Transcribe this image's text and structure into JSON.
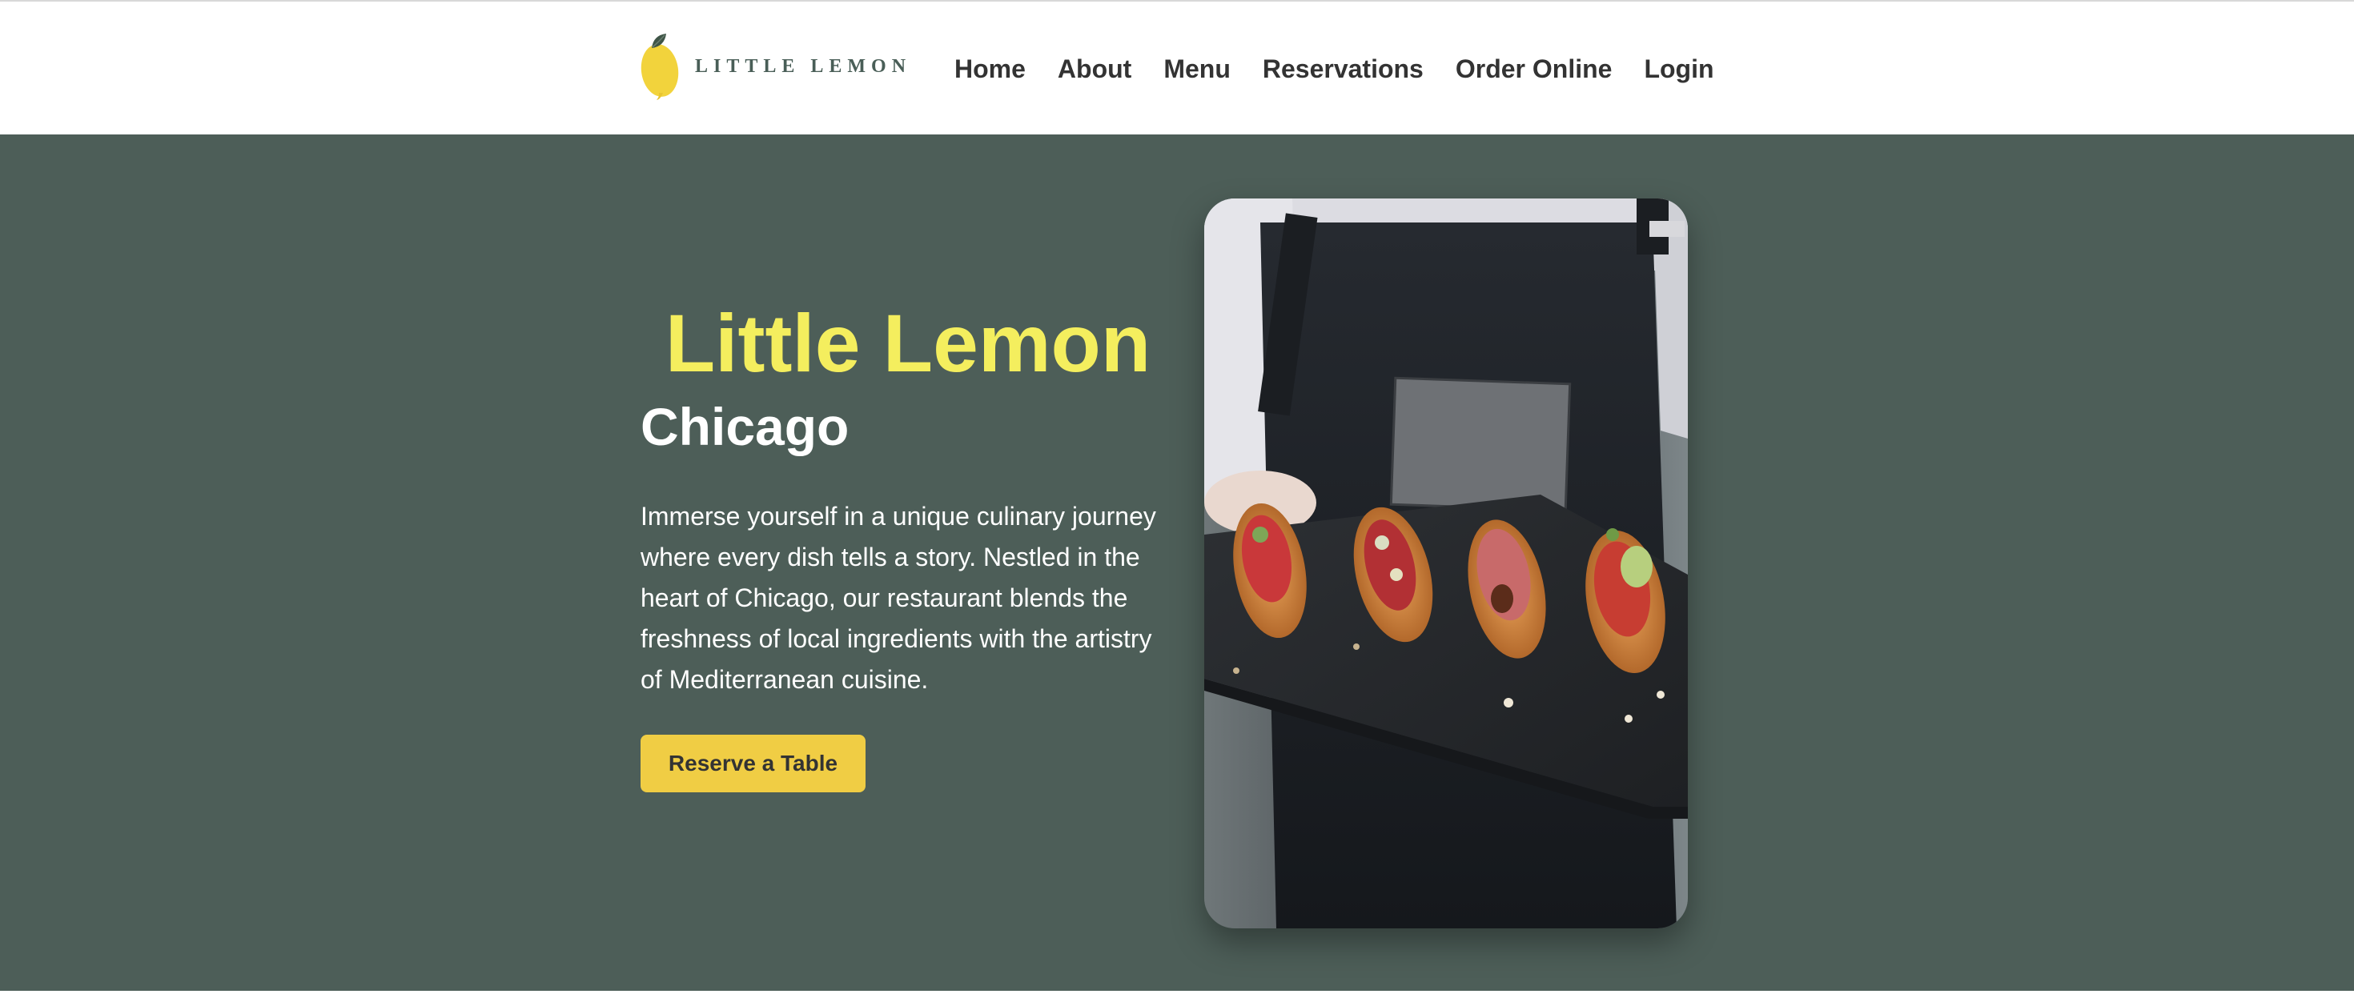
{
  "brand": {
    "logo_text": "LITTLE LEMON",
    "logo_icon": "lemon-icon",
    "primary_color": "#4d5e58",
    "accent_color": "#f4ee5e",
    "button_color": "#f0cd44"
  },
  "nav": {
    "items": [
      {
        "label": "Home"
      },
      {
        "label": "About"
      },
      {
        "label": "Menu"
      },
      {
        "label": "Reservations"
      },
      {
        "label": "Order Online"
      },
      {
        "label": "Login"
      }
    ]
  },
  "hero": {
    "title": "Little Lemon",
    "subtitle": "Chicago",
    "description": "Immerse yourself in a unique culinary journey where every dish tells a story. Nestled in the heart of Chicago, our restaurant blends the freshness of local ingredients with the artistry of Mediterranean cuisine.",
    "cta_label": "Reserve a Table",
    "image_subject": "chef holding slate tray of bruschetta"
  }
}
